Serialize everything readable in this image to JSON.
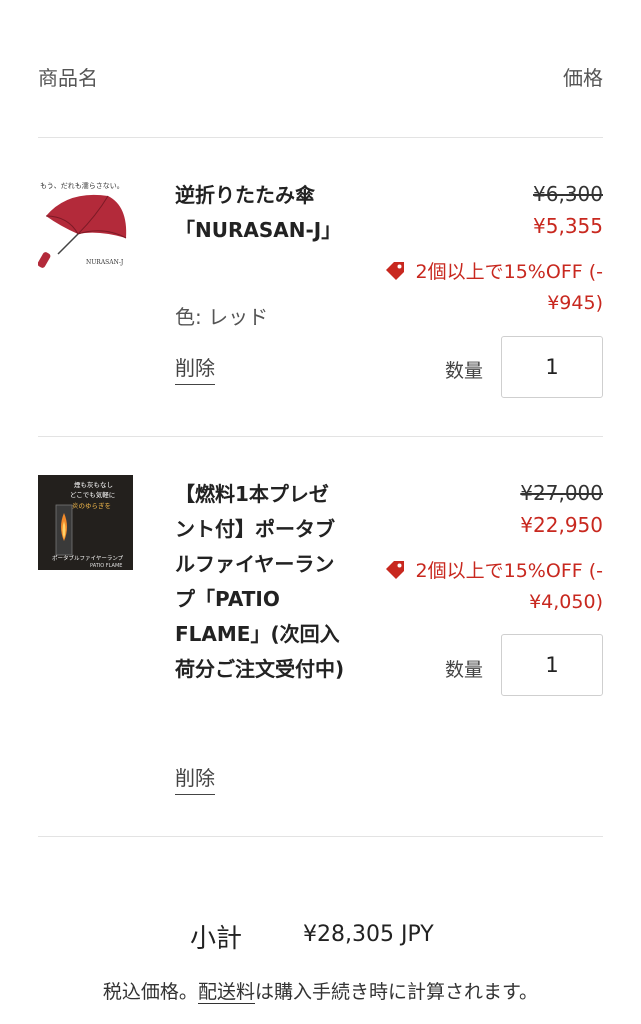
{
  "header": {
    "product_col": "商品名",
    "price_col": "価格"
  },
  "items": [
    {
      "title": "逆折りたたみ傘「NURASAN-J」",
      "variant": "色: レッド",
      "remove_label": "削除",
      "image_caption_top": "もう、だれも濡らさない。",
      "image_caption_bottom": "NURASAN-J",
      "price_original": "¥6,300",
      "price_sale": "¥5,355",
      "discount_text": "2個以上で15%OFF (-¥945)",
      "qty_label": "数量",
      "qty_value": "1"
    },
    {
      "title": "【燃料1本プレゼント付】ポータブルファイヤーランプ「PATIO FLAME」(次回入荷分ご注文受付中)",
      "remove_label": "削除",
      "image_caption_1": "煙も灰もなし",
      "image_caption_2": "どこでも気軽に",
      "image_caption_3": "炎のゆらぎを",
      "image_caption_4": "ポータブルファイヤーランプ",
      "image_caption_5": "PATIO FLAME",
      "price_original": "¥27,000",
      "price_sale": "¥22,950",
      "discount_text": "2個以上で15%OFF (-¥4,050)",
      "qty_label": "数量",
      "qty_value": "1"
    }
  ],
  "subtotal": {
    "label": "小計",
    "value": "¥28,305 JPY"
  },
  "note": {
    "prefix": "税込価格。",
    "link": "配送料",
    "suffix": "は購入手続き時に計算されます。"
  },
  "colors": {
    "sale": "#c8281f",
    "divider": "#e3e3e3",
    "umbrella": "#b32a3a"
  }
}
